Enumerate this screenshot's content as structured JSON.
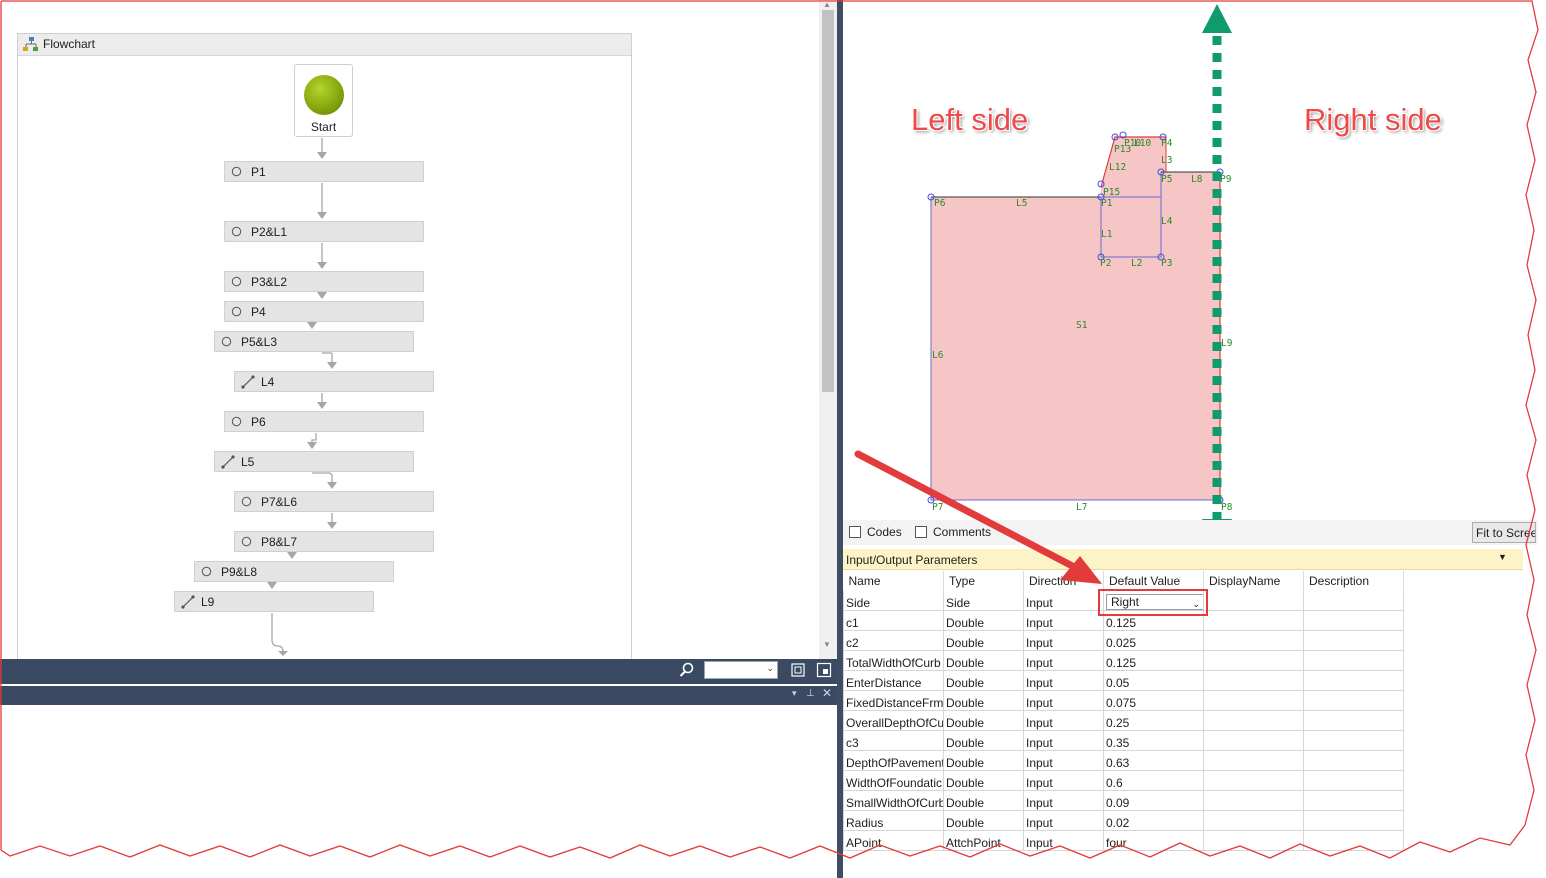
{
  "flowchart": {
    "title": "Flowchart",
    "start_label": "Start",
    "activities": [
      {
        "label": "P1",
        "kind": "point"
      },
      {
        "label": "P2&L1",
        "kind": "point"
      },
      {
        "label": "P3&L2",
        "kind": "point"
      },
      {
        "label": "P4",
        "kind": "point"
      },
      {
        "label": "P5&L3",
        "kind": "point"
      },
      {
        "label": "L4",
        "kind": "line"
      },
      {
        "label": "P6",
        "kind": "point"
      },
      {
        "label": "L5",
        "kind": "line"
      },
      {
        "label": "P7&L6",
        "kind": "point"
      },
      {
        "label": "P8&L7",
        "kind": "point"
      },
      {
        "label": "P9&L8",
        "kind": "point"
      },
      {
        "label": "L9",
        "kind": "line"
      }
    ]
  },
  "canvas": {
    "left_side_label": "Left side",
    "right_side_label": "Right side",
    "shape_labels": {
      "p1": "P1",
      "p2": "P2",
      "p3": "P3",
      "p4": "P4",
      "p5": "P5",
      "p6": "P6",
      "p7": "P7",
      "p8": "P8",
      "p9": "P9",
      "p13": "P13",
      "p15": "P15",
      "p10": "P10",
      "l1": "L1",
      "l2": "L2",
      "l3": "L3",
      "l4": "L4",
      "l5": "L5",
      "l6": "L6",
      "l7": "L7",
      "l8": "L8",
      "l9": "L9",
      "l12": "L12",
      "l10": "L10",
      "s1": "S1"
    },
    "codes_label": "Codes",
    "comments_label": "Comments",
    "fit_button": "Fit to Screen"
  },
  "params": {
    "title": "Input/Output Parameters",
    "columns": [
      "Name",
      "Type",
      "Direction",
      "Default Value",
      "DisplayName",
      "Description"
    ],
    "rows": [
      {
        "name": "Side",
        "type": "Side",
        "direction": "Input",
        "default": "Right",
        "display": "",
        "description": ""
      },
      {
        "name": "c1",
        "type": "Double",
        "direction": "Input",
        "default": "0.125",
        "display": "",
        "description": ""
      },
      {
        "name": "c2",
        "type": "Double",
        "direction": "Input",
        "default": "0.025",
        "display": "",
        "description": ""
      },
      {
        "name": "TotalWidthOfCurb",
        "type": "Double",
        "direction": "Input",
        "default": "0.125",
        "display": "",
        "description": ""
      },
      {
        "name": "EnterDistance",
        "type": "Double",
        "direction": "Input",
        "default": "0.05",
        "display": "",
        "description": ""
      },
      {
        "name": "FixedDistanceFrm",
        "type": "Double",
        "direction": "Input",
        "default": "0.075",
        "display": "",
        "description": ""
      },
      {
        "name": "OverallDepthOfCu",
        "type": "Double",
        "direction": "Input",
        "default": "0.25",
        "display": "",
        "description": ""
      },
      {
        "name": "c3",
        "type": "Double",
        "direction": "Input",
        "default": "0.35",
        "display": "",
        "description": ""
      },
      {
        "name": "DepthOfPavement",
        "type": "Double",
        "direction": "Input",
        "default": "0.63",
        "display": "",
        "description": ""
      },
      {
        "name": "WidthOfFoundatic",
        "type": "Double",
        "direction": "Input",
        "default": "0.6",
        "display": "",
        "description": ""
      },
      {
        "name": "SmallWidthOfCurb",
        "type": "Double",
        "direction": "Input",
        "default": "0.09",
        "display": "",
        "description": ""
      },
      {
        "name": "Radius",
        "type": "Double",
        "direction": "Input",
        "default": "0.02",
        "display": "",
        "description": ""
      },
      {
        "name": "APoint",
        "type": "AttchPoint",
        "direction": "Input",
        "default": "four",
        "display": "",
        "description": ""
      }
    ]
  },
  "colors": {
    "accent": "#ef4a4a",
    "teal": "#0f9b6e",
    "shape_fill": "#f6c6c6",
    "toolbar": "#3b4a63"
  }
}
